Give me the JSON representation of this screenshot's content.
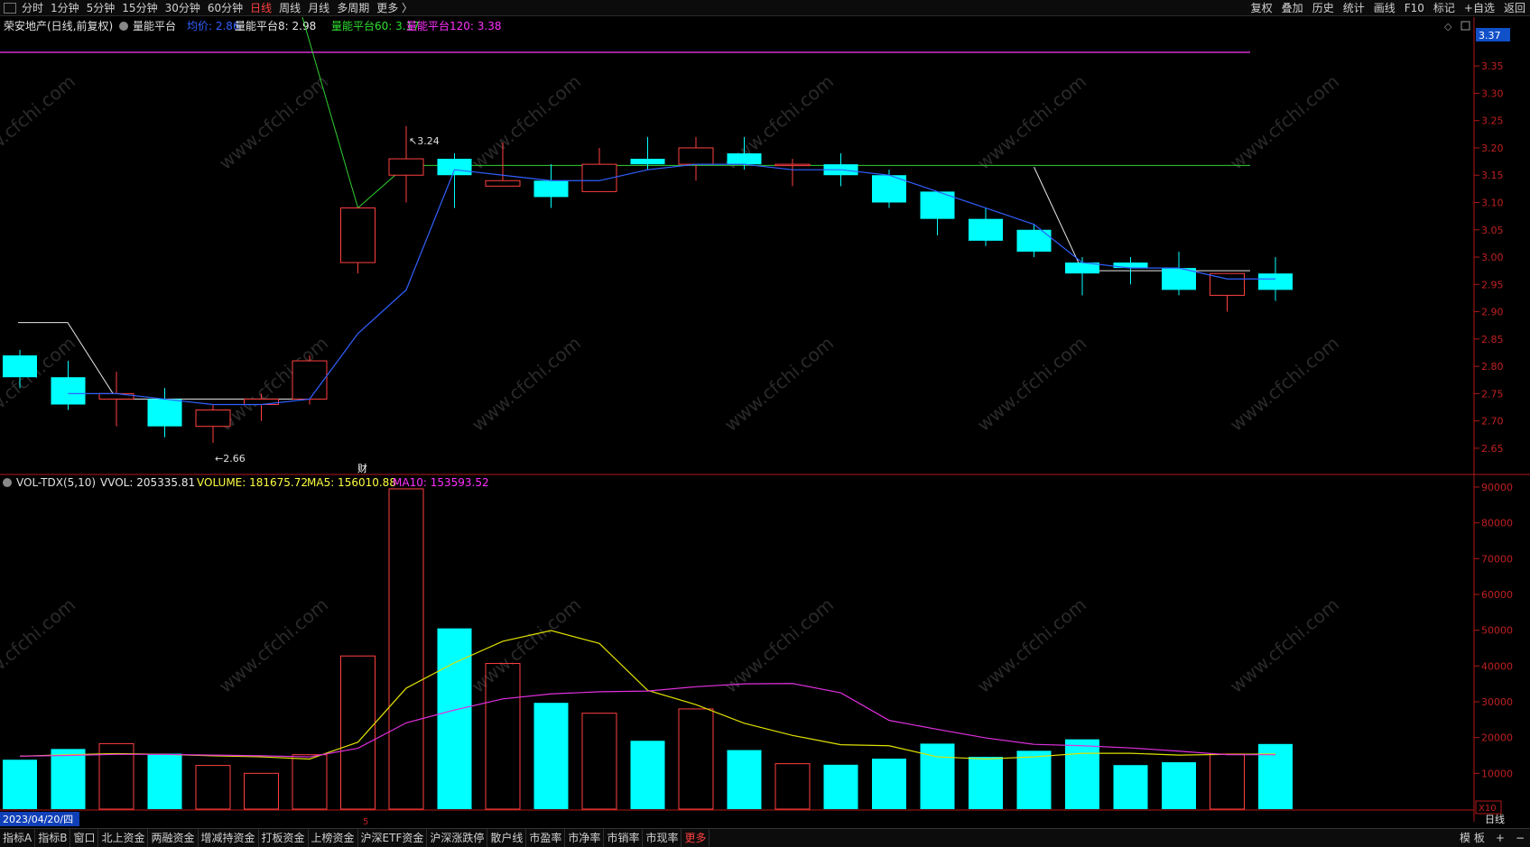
{
  "topbar": {
    "periods": [
      "分时",
      "1分钟",
      "5分钟",
      "15分钟",
      "30分钟",
      "60分钟",
      "日线",
      "周线",
      "月线",
      "多周期",
      "更多 〉"
    ],
    "active_period": "日线",
    "right": [
      "复权",
      "叠加",
      "历史",
      "统计",
      "画线",
      "F10",
      "标记",
      "+自选",
      "返回"
    ]
  },
  "main_header": {
    "stock": "荣安地产(日线,前复权)",
    "indicator": "量能平台",
    "items": [
      {
        "label": "均价: 2.86",
        "color": "#3060ff"
      },
      {
        "label": "量能平台8: 2.98",
        "color": "#e8e8e8"
      },
      {
        "label": "量能平台60: 3.17",
        "color": "#30e030"
      },
      {
        "label": "量能平台120: 3.38",
        "color": "#ff30ff"
      }
    ]
  },
  "vol_header": {
    "name": "VOL-TDX(5,10)",
    "items": [
      {
        "label": "VVOL: 205335.81",
        "color": "#e8e8e8"
      },
      {
        "label": "VOLUME: 181675.72",
        "color": "#ffff40"
      },
      {
        "label": "MA5: 156010.88",
        "color": "#ffff40"
      },
      {
        "label": "MA10: 153593.52",
        "color": "#ff30ff"
      }
    ]
  },
  "price_axis": {
    "ticks": [
      "3.35",
      "3.30",
      "3.25",
      "3.20",
      "3.15",
      "3.10",
      "3.05",
      "3.00",
      "2.95",
      "2.90",
      "2.85",
      "2.80",
      "2.75",
      "2.70",
      "2.65"
    ],
    "current": "3.37"
  },
  "volume_axis": {
    "ticks": [
      "90000",
      "80000",
      "70000",
      "60000",
      "50000",
      "40000",
      "30000",
      "20000",
      "10000"
    ],
    "multiplier": "X10"
  },
  "annotations": {
    "high": "3.24",
    "low": "2.66",
    "event": "财",
    "month_mark": "5"
  },
  "date_label": "2023/04/20/四",
  "period_label": "日线",
  "watermark": "www.cfchi.com",
  "chart_data": {
    "type": "candlestick",
    "price_range": [
      2.63,
      3.38
    ],
    "volume_range": [
      0,
      91000
    ],
    "candles": [
      {
        "o": 2.82,
        "h": 2.83,
        "l": 2.76,
        "c": 2.78,
        "v": 13800
      },
      {
        "o": 2.78,
        "h": 2.81,
        "l": 2.72,
        "c": 2.73,
        "v": 16800
      },
      {
        "o": 2.74,
        "h": 2.79,
        "l": 2.69,
        "c": 2.75,
        "v": 18300
      },
      {
        "o": 2.74,
        "h": 2.76,
        "l": 2.67,
        "c": 2.69,
        "v": 15500
      },
      {
        "o": 2.69,
        "h": 2.73,
        "l": 2.66,
        "c": 2.72,
        "v": 12200
      },
      {
        "o": 2.73,
        "h": 2.75,
        "l": 2.7,
        "c": 2.74,
        "v": 10000
      },
      {
        "o": 2.74,
        "h": 2.82,
        "l": 2.73,
        "c": 2.81,
        "v": 15200
      },
      {
        "o": 2.99,
        "h": 3.09,
        "l": 2.97,
        "c": 3.09,
        "v": 42800
      },
      {
        "o": 3.15,
        "h": 3.24,
        "l": 3.1,
        "c": 3.18,
        "v": 89500
      },
      {
        "o": 3.18,
        "h": 3.19,
        "l": 3.09,
        "c": 3.15,
        "v": 50500
      },
      {
        "o": 3.13,
        "h": 3.21,
        "l": 3.13,
        "c": 3.14,
        "v": 40700
      },
      {
        "o": 3.14,
        "h": 3.17,
        "l": 3.09,
        "c": 3.11,
        "v": 29700
      },
      {
        "o": 3.12,
        "h": 3.2,
        "l": 3.12,
        "c": 3.17,
        "v": 26800
      },
      {
        "o": 3.18,
        "h": 3.22,
        "l": 3.16,
        "c": 3.17,
        "v": 19100
      },
      {
        "o": 3.17,
        "h": 3.22,
        "l": 3.14,
        "c": 3.2,
        "v": 28000
      },
      {
        "o": 3.19,
        "h": 3.22,
        "l": 3.16,
        "c": 3.17,
        "v": 16500
      },
      {
        "o": 3.17,
        "h": 3.18,
        "l": 3.13,
        "c": 3.17,
        "v": 12700
      },
      {
        "o": 3.17,
        "h": 3.19,
        "l": 3.13,
        "c": 3.15,
        "v": 12400
      },
      {
        "o": 3.15,
        "h": 3.16,
        "l": 3.09,
        "c": 3.1,
        "v": 14100
      },
      {
        "o": 3.12,
        "h": 3.12,
        "l": 3.04,
        "c": 3.07,
        "v": 18300
      },
      {
        "o": 3.07,
        "h": 3.09,
        "l": 3.02,
        "c": 3.03,
        "v": 14600
      },
      {
        "o": 3.05,
        "h": 3.06,
        "l": 3.0,
        "c": 3.01,
        "v": 16300
      },
      {
        "o": 2.99,
        "h": 3.0,
        "l": 2.93,
        "c": 2.97,
        "v": 19500
      },
      {
        "o": 2.99,
        "h": 3.0,
        "l": 2.95,
        "c": 2.98,
        "v": 12300
      },
      {
        "o": 2.98,
        "h": 3.01,
        "l": 2.93,
        "c": 2.94,
        "v": 13100
      },
      {
        "o": 2.93,
        "h": 2.97,
        "l": 2.9,
        "c": 2.97,
        "v": 15400
      },
      {
        "o": 2.97,
        "h": 3.0,
        "l": 2.92,
        "c": 2.94,
        "v": 18200
      }
    ],
    "lines": {
      "avg_price": [
        null,
        2.75,
        2.75,
        2.74,
        2.73,
        2.73,
        2.74,
        2.86,
        2.94,
        3.16,
        3.15,
        3.14,
        3.14,
        3.16,
        3.17,
        3.17,
        3.16,
        3.16,
        3.15,
        3.12,
        3.09,
        3.06,
        2.99,
        2.98,
        2.98,
        2.96,
        2.96
      ],
      "ma5": [
        14800,
        15200,
        15500,
        15300,
        14900,
        14600,
        14000,
        18700,
        33800,
        40900,
        46900,
        49900,
        46300,
        33200,
        29200,
        24000,
        20600,
        18000,
        17700,
        14600,
        14000,
        14600,
        15600,
        15600,
        15100,
        15300,
        15400
      ],
      "ma10": [
        14800,
        15000,
        15300,
        15300,
        15100,
        14900,
        14600,
        17000,
        24100,
        27700,
        30800,
        32200,
        32800,
        33000,
        34200,
        35000,
        35100,
        32500,
        24800,
        22300,
        19900,
        18100,
        17700,
        17100,
        16200,
        15200,
        15200
      ]
    },
    "platform_levels": {
      "p8": 2.975,
      "p60": 3.168,
      "p120": 3.375
    }
  }
}
